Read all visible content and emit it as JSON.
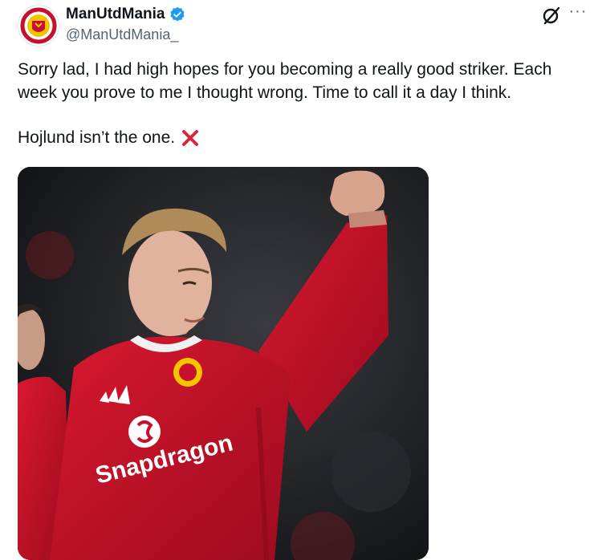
{
  "post": {
    "display_name": "ManUtdMania",
    "handle": "@ManUtdMania_",
    "text_line1": "Sorry lad, I had high hopes for you becoming a really good striker. Each week you prove to me I thought wrong. Time to call it a day I think.",
    "text_line2": "Hojlund isn’t the one.",
    "emoji": "cross-mark-icon",
    "verified": true
  },
  "media": {
    "sponsor_text": "Snapdragon",
    "description_colors": {
      "shirt": "#c8102e",
      "background": "#1b1c20"
    }
  },
  "icons": {
    "avatar": "manutdmania-logo",
    "verified": "verified-badge-icon",
    "grok": "grok-icon",
    "more": "more-options-icon"
  }
}
